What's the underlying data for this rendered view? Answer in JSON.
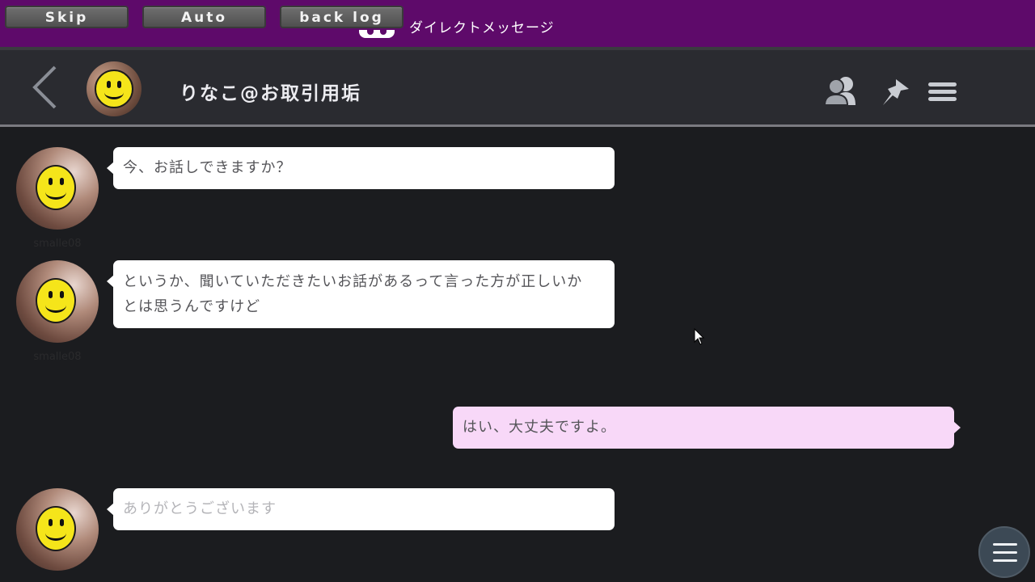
{
  "system_bar": {
    "skip_label": "Skip",
    "auto_label": "Auto",
    "backlog_label": "back log",
    "title": "ダイレクトメッセージ"
  },
  "chat_header": {
    "contact_name": "りなこ@お取引用垢",
    "icons": [
      "back-chevron-icon",
      "users-icon",
      "pin-icon",
      "menu-icon"
    ]
  },
  "messages": [
    {
      "side": "left",
      "username": "smalle08",
      "lines": [
        "今、お話しできますか？"
      ]
    },
    {
      "side": "left",
      "username": "smalle08",
      "lines": [
        "というか、聞いていただきたいお話があるって言った方が正しいか",
        "とは思うんですけど"
      ]
    },
    {
      "side": "right",
      "lines": [
        "はい、大丈夫ですよ。"
      ]
    },
    {
      "side": "left",
      "lines": [
        "ありがとうございます"
      ]
    }
  ],
  "colors": {
    "system_bar": "#5e0a6a",
    "chat_bg": "#1b1c1f",
    "header_bg": "#2a2b30",
    "bubble_incoming": "#ffffff",
    "bubble_outgoing": "#f8d8f8",
    "fab": "#3c4955"
  }
}
